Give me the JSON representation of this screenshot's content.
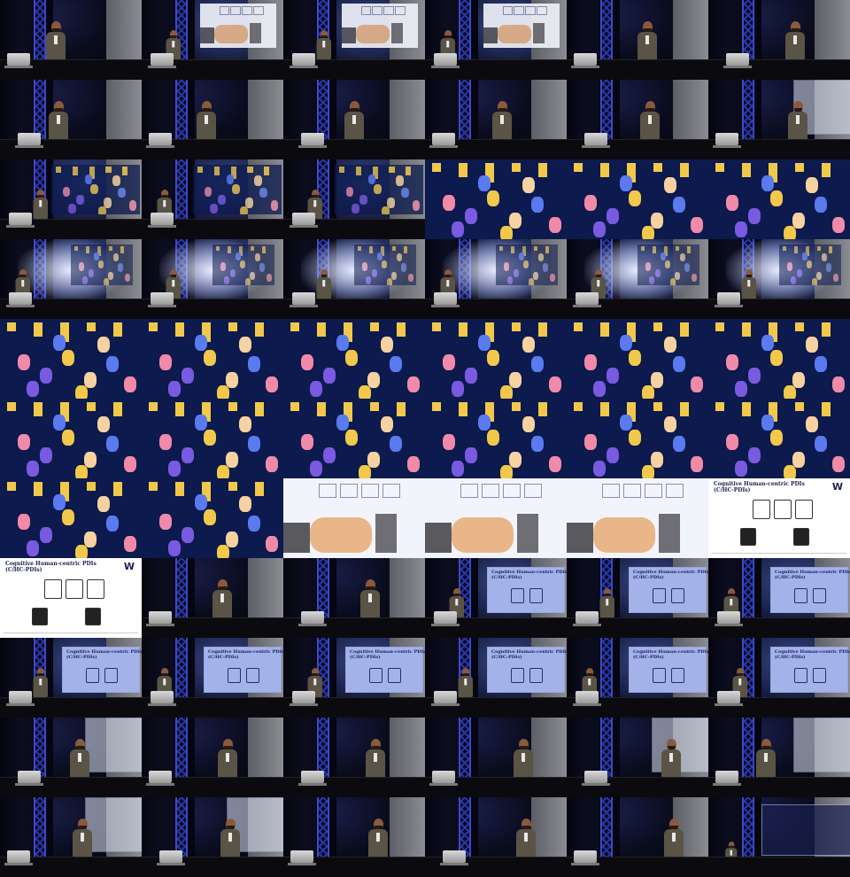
{
  "grid": {
    "columns": 6,
    "rows": 11,
    "cell_types": [
      [
        "stage-speaker",
        "stage-fist-screen",
        "stage-fist-screen",
        "stage-fist-screen",
        "stage-speaker",
        "stage-speaker"
      ],
      [
        "stage-speaker",
        "stage-speaker",
        "stage-speaker",
        "stage-speaker",
        "stage-speaker",
        "stage-speaker-fade"
      ],
      [
        "stage-cartoon-screen",
        "stage-cartoon-screen",
        "stage-cartoon-screen",
        "cartoon",
        "cartoon",
        "cartoon"
      ],
      [
        "stage-cartoon-bright",
        "stage-cartoon-bright",
        "stage-cartoon-bright",
        "stage-cartoon-bright",
        "stage-cartoon-bright",
        "stage-cartoon-bright"
      ],
      [
        "cartoon",
        "cartoon",
        "cartoon",
        "cartoon",
        "cartoon",
        "cartoon"
      ],
      [
        "cartoon",
        "cartoon",
        "cartoon",
        "cartoon",
        "cartoon",
        "cartoon"
      ],
      [
        "cartoon",
        "cartoon",
        "fist-slide",
        "fist-slide",
        "fist-slide",
        "diagram-slide"
      ],
      [
        "diagram-slide",
        "stage-speaker",
        "stage-speaker",
        "stage-slide-screen",
        "stage-slide-screen",
        "stage-slide-screen"
      ],
      [
        "stage-slide-screen",
        "stage-slide-screen",
        "stage-slide-screen",
        "stage-slide-screen",
        "stage-slide-screen",
        "stage-slide-screen"
      ],
      [
        "stage-speaker-fade",
        "stage-speaker",
        "stage-speaker",
        "stage-speaker",
        "stage-speaker-fade",
        "stage-speaker-fade"
      ],
      [
        "stage-speaker-fade",
        "stage-speaker-fade",
        "stage-speaker",
        "stage-speaker",
        "stage-speaker",
        "stage-dark"
      ]
    ]
  },
  "slide_text": {
    "diagram_title": "Cognitive Human-centric PDIs",
    "diagram_subtitle": "(C/HC-PDIs)",
    "logo": "W",
    "screen_title": "Cognitive Human-centric PDIs\n(C/HC-PDIs)"
  },
  "colors": {
    "stage_blue": "#1a1f4a",
    "truss_blue": "#3040d0",
    "cartoon_bg": "#0c1a4d",
    "cartoon_yellow": "#f2c84b",
    "cartoon_pink": "#f08aa8",
    "cartoon_purple": "#7a5ae0",
    "skin": "#e8b689"
  },
  "icons": [
    "speaker-figure",
    "laptop",
    "truss",
    "projection-screen",
    "fist-illustration",
    "cartoon-musicians",
    "diagram-servers"
  ]
}
